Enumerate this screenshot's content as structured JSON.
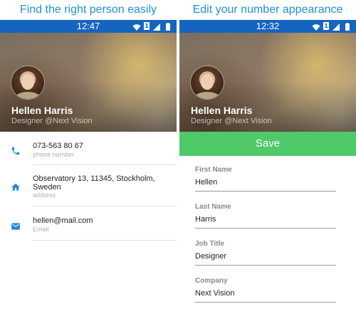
{
  "left": {
    "caption": "Find the right person easily",
    "status": {
      "time": "12:47"
    },
    "profile": {
      "name": "Hellen Harris",
      "role": "Designer @Next Vision"
    },
    "contact": [
      {
        "icon": "phone-icon",
        "value": "073-563 80 67",
        "label": "phone number"
      },
      {
        "icon": "home-icon",
        "value": "Observatory 13, 11345, Stockholm, Sweden",
        "label": "address"
      },
      {
        "icon": "email-icon",
        "value": "hellen@mail.com",
        "label": "Email"
      }
    ]
  },
  "right": {
    "caption": "Edit your number appearance",
    "status": {
      "time": "12:32"
    },
    "profile": {
      "name": "Hellen Harris",
      "role": "Designer @Next Vision"
    },
    "save_label": "Save",
    "fields": [
      {
        "label": "First Name",
        "value": "Hellen"
      },
      {
        "label": "Last Name",
        "value": "Harris"
      },
      {
        "label": "Job Title",
        "value": "Designer"
      },
      {
        "label": "Company",
        "value": "Next Vision"
      }
    ]
  },
  "colors": {
    "caption": "#1f8fd6",
    "statusbar": "#1565c0",
    "save": "#4fc96a",
    "icon": "#1e88e5"
  }
}
